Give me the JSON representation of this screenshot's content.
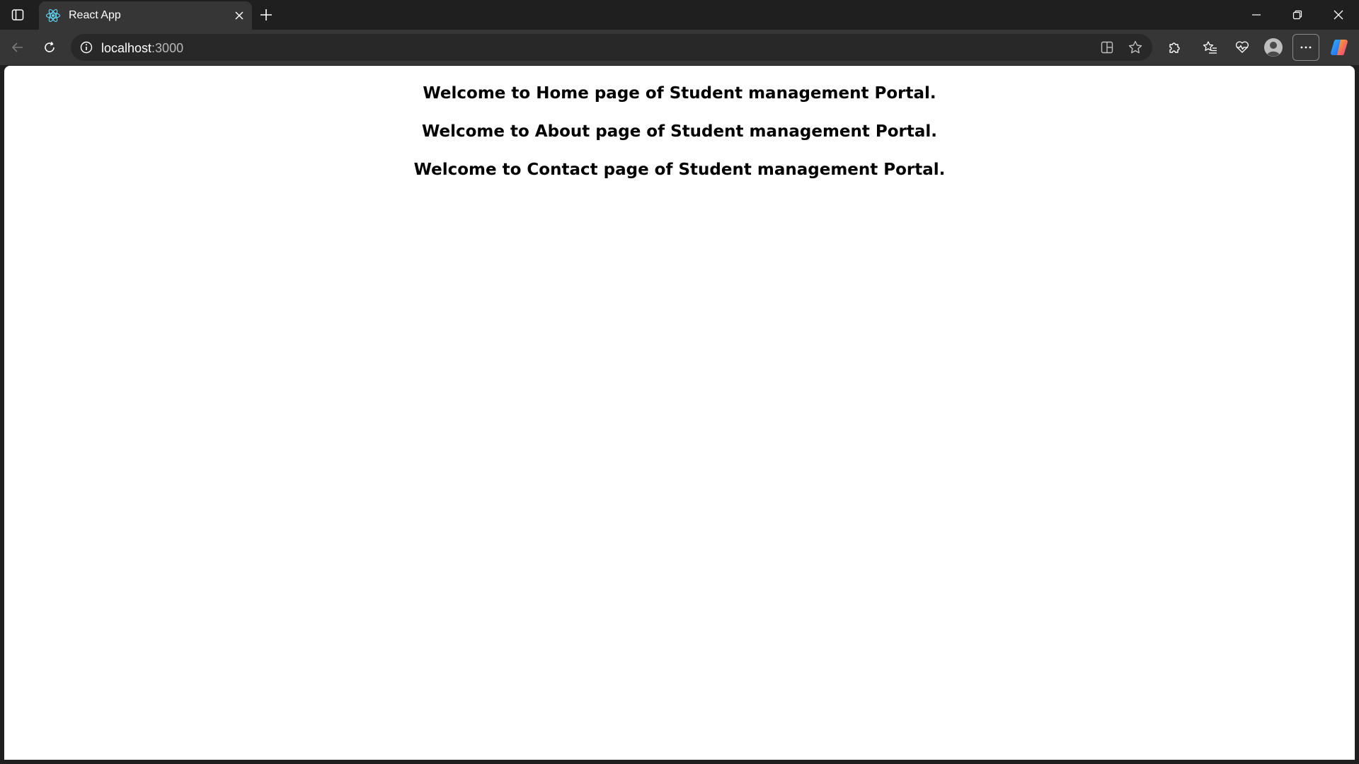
{
  "browser": {
    "tab": {
      "title": "React App",
      "favicon": "react-logo-icon"
    },
    "address_bar": {
      "host": "localhost",
      "port": ":3000"
    },
    "icons": {
      "tab_actions": "tab-actions-icon",
      "close_tab": "close-icon",
      "new_tab": "plus-icon",
      "minimize": "minimize-icon",
      "maximize": "restore-icon",
      "close_window": "close-icon",
      "back": "arrow-left-icon",
      "reload": "reload-icon",
      "site_info": "info-icon",
      "split_screen": "split-screen-icon",
      "favorite": "star-icon",
      "extensions": "puzzle-icon",
      "favorites": "favorites-icon",
      "browser_essentials": "heart-pulse-icon",
      "profile": "avatar-icon",
      "more": "more-icon",
      "copilot": "copilot-icon"
    },
    "colors": {
      "chrome_bg": "#1f1f1f",
      "toolbar_bg": "#363636",
      "page_bg": "#ffffff",
      "text": "#000000"
    }
  },
  "page": {
    "headings": [
      "Welcome to Home page of Student management Portal.",
      "Welcome to About page of Student management Portal.",
      "Welcome to Contact page of Student management Portal."
    ]
  }
}
